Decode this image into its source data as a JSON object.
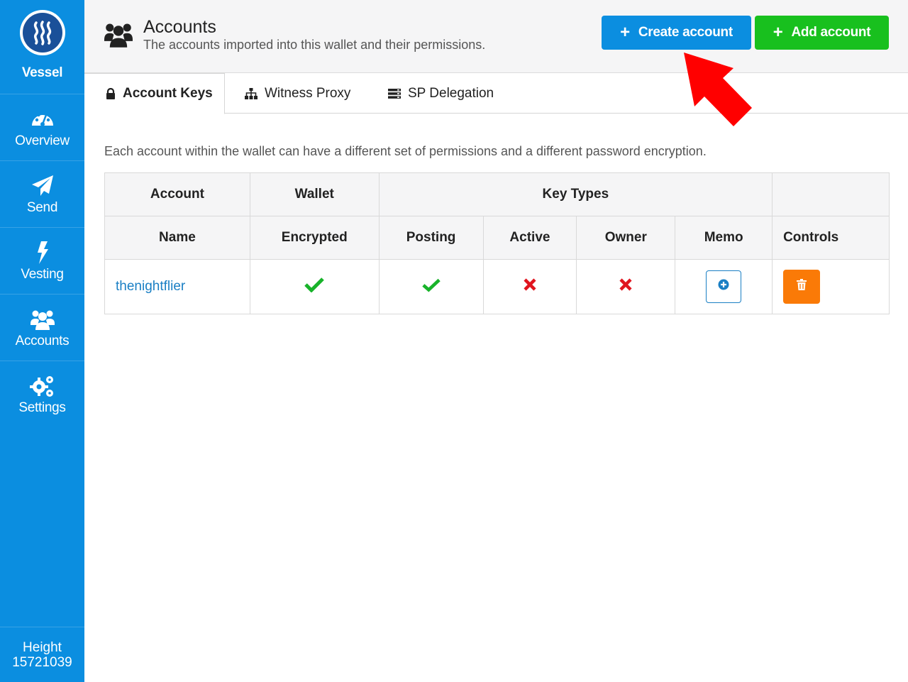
{
  "app": {
    "brand": "Vessel",
    "height_label": "Height",
    "height_value": "15721039"
  },
  "sidebar": {
    "items": [
      {
        "label": "Overview",
        "icon": "dashboard-icon"
      },
      {
        "label": "Send",
        "icon": "paper-plane-icon"
      },
      {
        "label": "Vesting",
        "icon": "lightning-icon"
      },
      {
        "label": "Accounts",
        "icon": "users-icon"
      },
      {
        "label": "Settings",
        "icon": "gears-icon"
      }
    ]
  },
  "header": {
    "title": "Accounts",
    "subtitle": "The accounts imported into this wallet and their permissions.",
    "create_label": "Create account",
    "add_label": "Add account"
  },
  "tabs": [
    {
      "label": "Account Keys",
      "icon": "lock-icon",
      "active": true
    },
    {
      "label": "Witness Proxy",
      "icon": "sitemap-icon",
      "active": false
    },
    {
      "label": "SP Delegation",
      "icon": "server-icon",
      "active": false
    }
  ],
  "description": "Each account within the wallet can have a different set of permissions and a different password encryption.",
  "table": {
    "group_headers": [
      "Account",
      "Wallet",
      "Key Types",
      ""
    ],
    "headers": [
      "Name",
      "Encrypted",
      "Posting",
      "Active",
      "Owner",
      "Memo",
      "Controls"
    ],
    "rows": [
      {
        "name": "thenightflier",
        "encrypted": true,
        "posting": true,
        "active": false,
        "owner": false
      }
    ]
  },
  "colors": {
    "sidebar": "#0b8ee0",
    "create_button": "#0b8ee0",
    "add_button": "#18c01e",
    "delete_button": "#fa7a07",
    "check": "#18b32a",
    "cross": "#e0141e",
    "annotation_arrow": "#ff0000"
  }
}
